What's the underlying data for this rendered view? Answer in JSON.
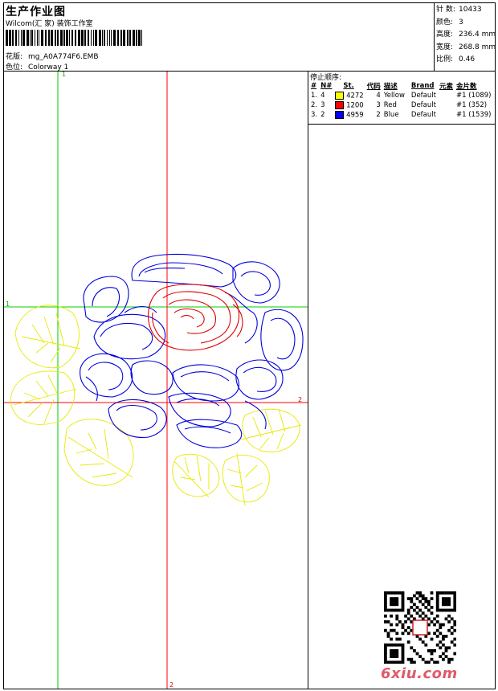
{
  "header": {
    "title": "生产作业图",
    "subtitle": "Wilcom(汇 家) 装饰工作室",
    "pattern_label": "花版:",
    "pattern_value": "mg_A0A774F6.EMB",
    "colorway_label": "色位:",
    "colorway_value": "Colorway 1"
  },
  "stats": [
    {
      "label": "针 数:",
      "value": "10433"
    },
    {
      "label": "颜色:",
      "value": "3"
    },
    {
      "label": "高度:",
      "value": "236.4 mm"
    },
    {
      "label": "宽度:",
      "value": "268.8 mm"
    },
    {
      "label": "比例:",
      "value": "0.46"
    }
  ],
  "stop_sequence": {
    "title": "停止顺序:",
    "columns": [
      "#",
      "N#",
      "St.",
      "代码",
      "描述",
      "Brand",
      "元素",
      "金片数"
    ],
    "rows": [
      {
        "idx": "1.",
        "needle": "4",
        "color": "#ffff00",
        "stitches": "4272",
        "code": "4",
        "desc": "Yellow",
        "brand": "Default",
        "element": "",
        "seq": "#1 (1089)"
      },
      {
        "idx": "2.",
        "needle": "3",
        "color": "#ff0000",
        "stitches": "1200",
        "code": "3",
        "desc": "Red",
        "brand": "Default",
        "element": "",
        "seq": "#1 (352)"
      },
      {
        "idx": "3.",
        "needle": "2",
        "color": "#0000ff",
        "stitches": "4959",
        "code": "2",
        "desc": "Blue",
        "brand": "Default",
        "element": "",
        "seq": "#1 (1539)"
      }
    ]
  },
  "axes": {
    "label_1": "1",
    "label_2": "2"
  },
  "watermark": "6xiu.com",
  "colors": {
    "yellow": "#ffff00",
    "red": "#ff0000",
    "blue": "#0000ff",
    "axis_green": "#00cc00",
    "axis_red": "#ff0000"
  }
}
